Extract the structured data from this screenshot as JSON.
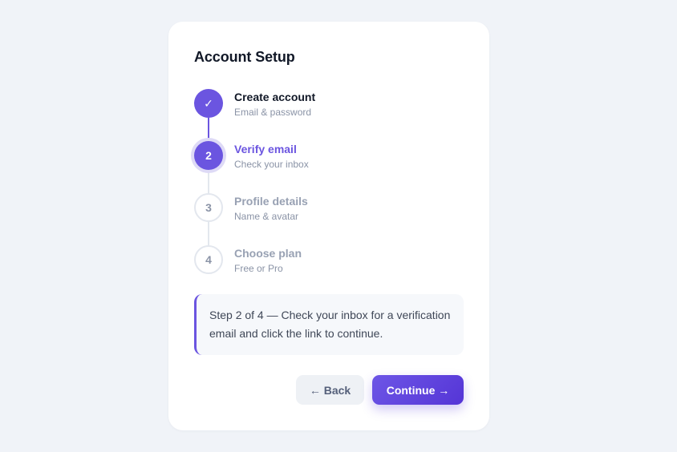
{
  "card": {
    "title": "Account Setup"
  },
  "steps": [
    {
      "number": "✓",
      "label": "Create account",
      "sub": "Email & password",
      "state": "done"
    },
    {
      "number": "2",
      "label": "Verify email",
      "sub": "Check your inbox",
      "state": "active"
    },
    {
      "number": "3",
      "label": "Profile details",
      "sub": "Name & avatar",
      "state": "todo"
    },
    {
      "number": "4",
      "label": "Choose plan",
      "sub": "Free or Pro",
      "state": "todo"
    }
  ],
  "info": {
    "text": "Step 2 of 4 — Check your inbox for a verification email and click the link to continue."
  },
  "buttons": {
    "back_label": "← Back",
    "continue_label": "Continue →"
  },
  "colors": {
    "accent": "#6b55e0",
    "background": "#f0f3f8",
    "card": "#ffffff"
  }
}
